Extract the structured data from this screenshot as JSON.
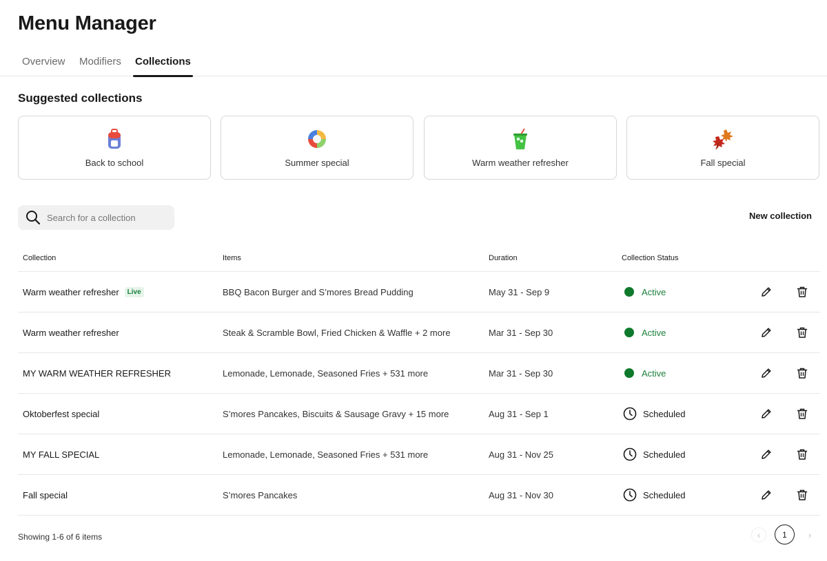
{
  "header": {
    "title": "Menu Manager"
  },
  "tabs": [
    {
      "label": "Overview",
      "active": false
    },
    {
      "label": "Modifiers",
      "active": false
    },
    {
      "label": "Collections",
      "active": true
    }
  ],
  "suggested": {
    "title": "Suggested collections",
    "cards": [
      {
        "label": "Back to school",
        "icon": "backpack-icon"
      },
      {
        "label": "Summer special",
        "icon": "beach-ball-icon"
      },
      {
        "label": "Warm weather refresher",
        "icon": "drink-cup-icon"
      },
      {
        "label": "Fall special",
        "icon": "maple-leaves-icon"
      }
    ]
  },
  "search": {
    "placeholder": "Search for a collection",
    "value": ""
  },
  "actions": {
    "new_collection": "New collection"
  },
  "table": {
    "headers": {
      "collection": "Collection",
      "items": "Items",
      "duration": "Duration",
      "status": "Collection Status"
    },
    "rows": [
      {
        "collection": "Warm weather refresher",
        "badge": "Live",
        "items": "BBQ Bacon Burger and S’mores Bread Pudding",
        "duration": "May 31 - Sep 9",
        "status": "Active"
      },
      {
        "collection": "Warm weather refresher",
        "badge": "",
        "items": "Steak & Scramble Bowl, Fried Chicken & Waffle + 2 more",
        "duration": "Mar 31 - Sep 30",
        "status": "Active"
      },
      {
        "collection": "MY WARM WEATHER REFRESHER",
        "badge": "",
        "items": "Lemonade, Lemonade, Seasoned Fries + 531 more",
        "duration": "Mar 31 - Sep 30",
        "status": "Active"
      },
      {
        "collection": "Oktoberfest special",
        "badge": "",
        "items": "S’mores Pancakes, Biscuits & Sausage Gravy + 15 more",
        "duration": "Aug 31 - Sep 1",
        "status": "Scheduled"
      },
      {
        "collection": "MY FALL SPECIAL",
        "badge": "",
        "items": "Lemonade, Lemonade, Seasoned Fries + 531 more",
        "duration": "Aug 31 - Nov 25",
        "status": "Scheduled"
      },
      {
        "collection": "Fall special",
        "badge": "",
        "items": "S’mores Pancakes",
        "duration": "Aug 31 - Nov 30",
        "status": "Scheduled"
      }
    ]
  },
  "footer": {
    "showing": "Showing 1-6 of 6 items",
    "pagination": {
      "current": "1",
      "prev": "‹",
      "next": "›"
    }
  },
  "colors": {
    "active_green": "#0f7a2c",
    "active_text": "#1b7f3b",
    "text_primary": "#191919"
  }
}
